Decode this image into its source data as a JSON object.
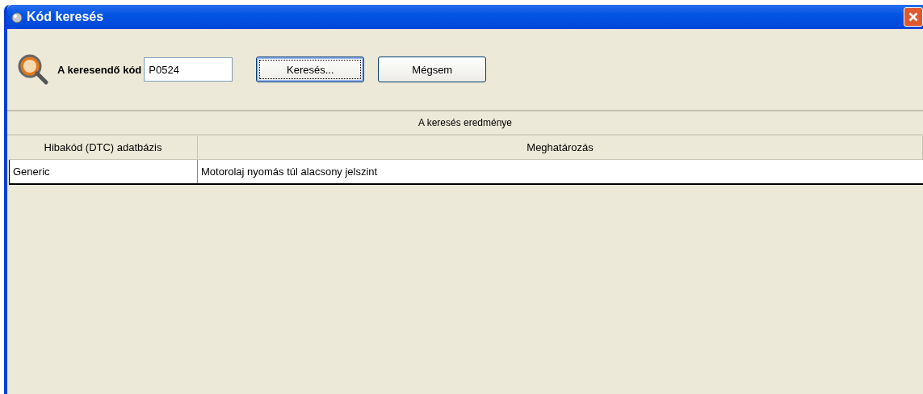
{
  "window": {
    "title": "Kód keresés"
  },
  "search": {
    "label": "A keresendő kód",
    "value": "P0524"
  },
  "buttons": [
    {
      "label": "Keresés...",
      "focused": true
    },
    {
      "label": "Mégsem",
      "focused": false
    }
  ],
  "results": {
    "title": "A keresés eredménye",
    "columns": [
      "Hibakód (DTC) adatbázis",
      "Meghatározás"
    ],
    "rows": [
      [
        "Generic",
        "Motorolaj nyomás túl alacsony jelszint"
      ]
    ]
  }
}
